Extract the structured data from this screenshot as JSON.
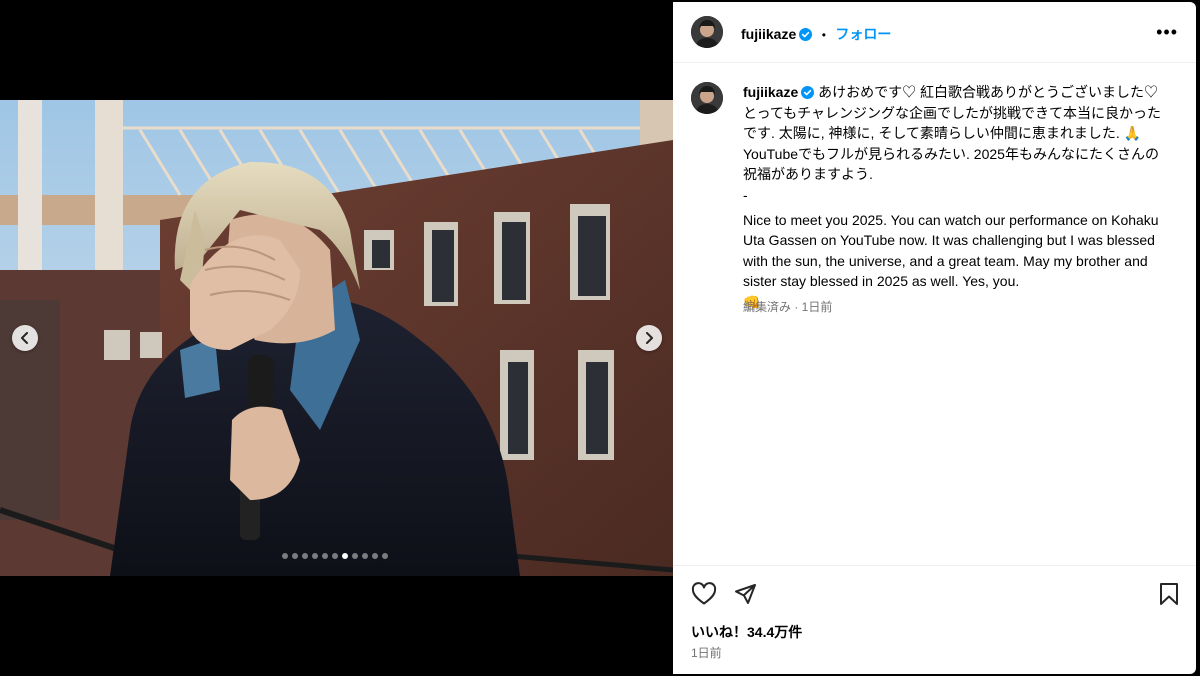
{
  "media": {
    "carousel_total": 11,
    "carousel_active": 7,
    "prev_icon": "chevron-left-icon",
    "next_icon": "chevron-right-icon"
  },
  "post": {
    "username": "fujiikaze",
    "separator": "•",
    "follow_label": "フォロー",
    "more_label": "•••",
    "caption_user": "fujiikaze",
    "caption_jp": "あけおめです♡ 紅白歌合戦ありがとうございました♡ とってもチャレンジングな企画でしたが挑戦できて本当に良かったです. 太陽に, 神様に, そして素晴らしい仲間に恵まれました. 🙏 YouTubeでもフルが見られるみたい. 2025年もみんなにたくさんの祝福がありますよう.",
    "caption_dash": "-",
    "caption_en": "Nice to meet you 2025. You can watch our performance on Kohaku Uta Gassen on YouTube now. It was challenging but I was blessed with the sun, the universe, and a great team. May my brother and sister stay blessed in 2025 as well. Yes, you.",
    "caption_emoji": "👊",
    "edited_meta": "編集済み · 1日前",
    "likes": "いいね！34.4万件",
    "time": "1日前"
  },
  "colors": {
    "accent": "#0095f6",
    "verified": "#0095f6",
    "muted": "#737373"
  }
}
